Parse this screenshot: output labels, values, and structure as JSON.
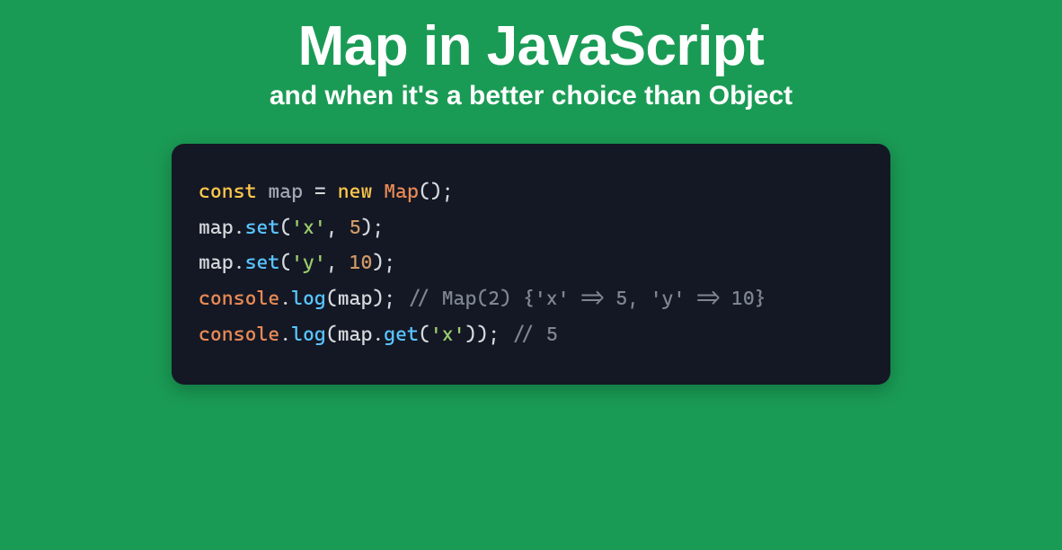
{
  "header": {
    "title": "Map in JavaScript",
    "subtitle": "and when it's a better choice than Object"
  },
  "code": {
    "lines": [
      [
        {
          "t": "const ",
          "c": "kw"
        },
        {
          "t": "map",
          "c": "pale"
        },
        {
          "t": " = ",
          "c": "op"
        },
        {
          "t": "new ",
          "c": "kw"
        },
        {
          "t": "Map",
          "c": "cls"
        },
        {
          "t": "();",
          "c": "op"
        }
      ],
      [
        {
          "t": "map",
          "c": "id"
        },
        {
          "t": ".",
          "c": "op"
        },
        {
          "t": "set",
          "c": "func"
        },
        {
          "t": "(",
          "c": "op"
        },
        {
          "t": "'x'",
          "c": "str"
        },
        {
          "t": ", ",
          "c": "op"
        },
        {
          "t": "5",
          "c": "num"
        },
        {
          "t": ");",
          "c": "op"
        }
      ],
      [
        {
          "t": "map",
          "c": "id"
        },
        {
          "t": ".",
          "c": "op"
        },
        {
          "t": "set",
          "c": "func"
        },
        {
          "t": "(",
          "c": "op"
        },
        {
          "t": "'y'",
          "c": "str"
        },
        {
          "t": ", ",
          "c": "op"
        },
        {
          "t": "10",
          "c": "num"
        },
        {
          "t": ");",
          "c": "op"
        }
      ],
      [
        {
          "t": "console",
          "c": "prop"
        },
        {
          "t": ".",
          "c": "op"
        },
        {
          "t": "log",
          "c": "func"
        },
        {
          "t": "(",
          "c": "op"
        },
        {
          "t": "map",
          "c": "id"
        },
        {
          "t": "); ",
          "c": "op"
        },
        {
          "t": "// Map(2) {'x' => 5, 'y' => 10}",
          "c": "cmt"
        }
      ],
      [
        {
          "t": "console",
          "c": "prop"
        },
        {
          "t": ".",
          "c": "op"
        },
        {
          "t": "log",
          "c": "func"
        },
        {
          "t": "(",
          "c": "op"
        },
        {
          "t": "map",
          "c": "id"
        },
        {
          "t": ".",
          "c": "op"
        },
        {
          "t": "get",
          "c": "func"
        },
        {
          "t": "(",
          "c": "op"
        },
        {
          "t": "'x'",
          "c": "str"
        },
        {
          "t": ")); ",
          "c": "op"
        },
        {
          "t": "// 5",
          "c": "cmt"
        }
      ]
    ]
  }
}
